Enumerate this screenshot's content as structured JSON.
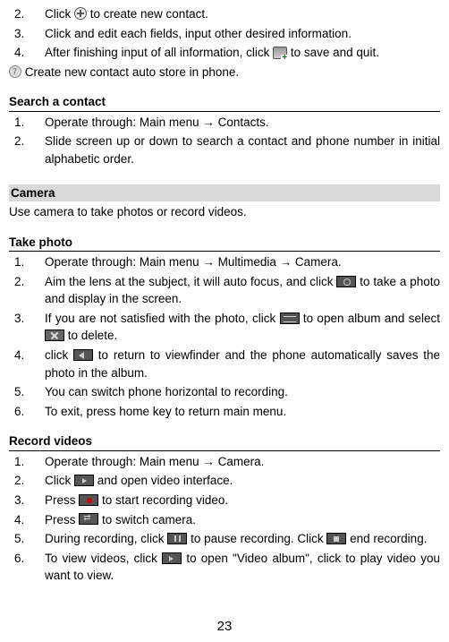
{
  "top_steps": [
    {
      "n": "2.",
      "pre": "Click ",
      "icon": "add",
      "post": " to create new contact."
    },
    {
      "n": "3.",
      "pre": "Click and edit each fields, input other desired information.",
      "icon": null,
      "post": ""
    },
    {
      "n": "4.",
      "pre": "After finishing input of all information, click ",
      "icon": "save",
      "post": " to save and quit."
    }
  ],
  "tip_line": {
    "icon": "tip",
    "text": " Create new contact auto store in phone."
  },
  "search": {
    "title": "Search a contact",
    "steps": [
      {
        "n": "1.",
        "text": "Operate through: Main menu → Contacts."
      },
      {
        "n": "2.",
        "text": "Slide screen up or down to search a contact and phone number in initial alphabetic order."
      }
    ]
  },
  "camera_title": "Camera",
  "camera_intro": "Use camera to take photos or record videos.",
  "take_photo": {
    "title": "Take photo",
    "steps": [
      {
        "n": "1.",
        "parts": [
          {
            "t": "Operate through: Main menu → Multimedia → Camera."
          }
        ]
      },
      {
        "n": "2.",
        "parts": [
          {
            "t": "Aim the lens at the subject, it will auto focus, and click "
          },
          {
            "i": "camera"
          },
          {
            "t": " to take a photo and display in the screen."
          }
        ]
      },
      {
        "n": "3.",
        "parts": [
          {
            "t": "If you are not satisfied with the photo, click "
          },
          {
            "i": "album"
          },
          {
            "t": " to open album and select "
          },
          {
            "i": "delete"
          },
          {
            "t": " to delete."
          }
        ]
      },
      {
        "n": "4.",
        "parts": [
          {
            "t": "click "
          },
          {
            "i": "back"
          },
          {
            "t": " to return to viewfinder and the phone automatically saves the photo in the album."
          }
        ]
      },
      {
        "n": "5.",
        "parts": [
          {
            "t": "You can switch phone horizontal to recording."
          }
        ]
      },
      {
        "n": "6.",
        "parts": [
          {
            "t": "To exit, press home key to return main menu."
          }
        ]
      }
    ]
  },
  "record": {
    "title": "Record videos",
    "steps": [
      {
        "n": "1.",
        "parts": [
          {
            "t": "Operate through: Main menu → Camera."
          }
        ]
      },
      {
        "n": "2.",
        "parts": [
          {
            "t": "Click "
          },
          {
            "i": "video"
          },
          {
            "t": " and open video interface."
          }
        ]
      },
      {
        "n": "3.",
        "parts": [
          {
            "t": "Press "
          },
          {
            "i": "rec"
          },
          {
            "t": " to start recording video."
          }
        ]
      },
      {
        "n": "4.",
        "parts": [
          {
            "t": "Press "
          },
          {
            "i": "switch"
          },
          {
            "t": " to switch camera."
          }
        ]
      },
      {
        "n": "5.",
        "parts": [
          {
            "t": "During recording, click "
          },
          {
            "i": "pause"
          },
          {
            "t": " to pause recording. Click "
          },
          {
            "i": "end"
          },
          {
            "t": " end recording."
          }
        ]
      },
      {
        "n": "6.",
        "parts": [
          {
            "t": "To view videos, click "
          },
          {
            "i": "vidalbum"
          },
          {
            "t": " to open \"Video album\", click to play video you want to view."
          }
        ]
      }
    ]
  },
  "page_number": "23"
}
